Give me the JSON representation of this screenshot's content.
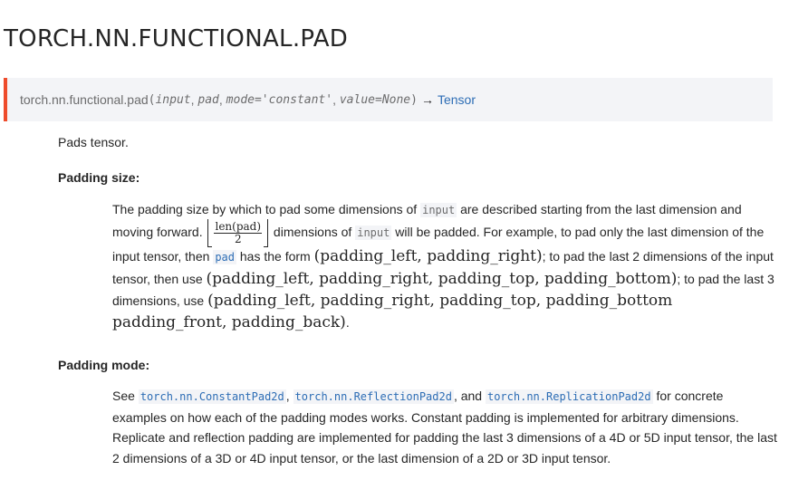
{
  "title": "TORCH.NN.FUNCTIONAL.PAD",
  "signature": {
    "name": "torch.nn.functional.pad",
    "open_paren": "(",
    "arg_input": "input",
    "sep": ", ",
    "arg_pad": "pad",
    "arg_mode": "mode='constant'",
    "arg_value": "value=None",
    "close_paren": ")",
    "arrow": "→",
    "return_type": "Tensor"
  },
  "description": "Pads tensor.",
  "padding_size": {
    "heading": "Padding size:",
    "t1": "The padding size by which to pad some dimensions of ",
    "code_input": "input",
    "t2": " are described starting from the last dimension and moving forward. ",
    "frac_num": "len(pad)",
    "frac_den": "2",
    "t3": " dimensions of ",
    "code_input2": "input",
    "t4": " will be padded. For example, to pad only the last dimension of the input tensor, then ",
    "code_pad": "pad",
    "t5": " has the form ",
    "math1": "(padding_left, padding_right)",
    "t6": "; to pad the last 2 dimensions of the input tensor, then use ",
    "math2": "(padding_left, padding_right, padding_top, padding_bottom)",
    "t7": "; to pad the last 3 dimensions, use ",
    "math3": "(padding_left, padding_right, padding_top, padding_bottom padding_front, padding_back)",
    "t8": "."
  },
  "padding_mode": {
    "heading": "Padding mode:",
    "t1": "See ",
    "link1": "torch.nn.ConstantPad2d",
    "sep1": ", ",
    "link2": "torch.nn.ReflectionPad2d",
    "t2": ", and ",
    "link3": "torch.nn.ReplicationPad2d",
    "t3": " for concrete examples on how each of the padding modes works. Constant padding is implemented for arbitrary dimensions. Replicate and reflection padding are implemented for padding the last 3 dimensions of a 4D or 5D input tensor, the last 2 dimensions of a 3D or 4D input tensor, or the last dimension of a 2D or 3D input tensor."
  },
  "colors": {
    "accent": "#ee4c2c",
    "link": "#2d6db5",
    "signature_bg": "#f3f4f7",
    "text": "#262626"
  }
}
